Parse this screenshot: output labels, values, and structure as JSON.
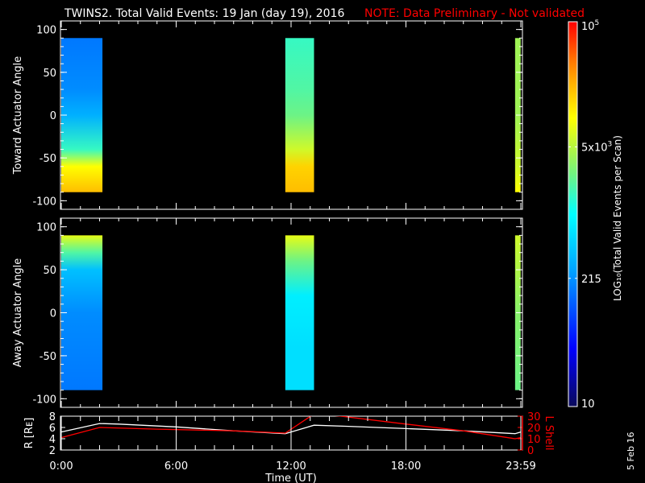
{
  "title": "TWINS2. Total Valid Events: 19 Jan (day  19), 2016",
  "note": "NOTE: Data Preliminary - Not validated",
  "colors": {
    "note": "#ff0000",
    "axis": "#ffffff",
    "lshell": "#ff0000",
    "r": "#ffffff"
  },
  "date_stamp": "5 Feb 16",
  "chart_data": [
    {
      "type": "heatmap",
      "ylabel": "Toward Actuator Angle",
      "ylim": [
        -110,
        110
      ],
      "yticks": [
        "100",
        "50",
        "0",
        "-50",
        "-100"
      ],
      "xlim_hours": [
        0,
        24
      ],
      "blocks": [
        {
          "start_h": 0.0,
          "end_h": 2.15,
          "angle_profile": [
            {
              "angle": 90,
              "log": 2.2
            },
            {
              "angle": 30,
              "log": 2.3
            },
            {
              "angle": 0,
              "log": 2.5
            },
            {
              "angle": -40,
              "log": 3.2
            },
            {
              "angle": -60,
              "log": 4.0
            },
            {
              "angle": -90,
              "log": 4.3
            }
          ]
        },
        {
          "start_h": 11.7,
          "end_h": 13.2,
          "angle_profile": [
            {
              "angle": 90,
              "log": 3.2
            },
            {
              "angle": 30,
              "log": 3.3
            },
            {
              "angle": 0,
              "log": 3.4
            },
            {
              "angle": -40,
              "log": 3.8
            },
            {
              "angle": -60,
              "log": 4.2
            },
            {
              "angle": -90,
              "log": 4.3
            }
          ]
        },
        {
          "start_h": 23.7,
          "end_h": 23.99,
          "angle_profile": [
            {
              "angle": 90,
              "log": 3.6
            },
            {
              "angle": 0,
              "log": 3.6
            },
            {
              "angle": -60,
              "log": 3.8
            },
            {
              "angle": -90,
              "log": 4.0
            }
          ]
        }
      ]
    },
    {
      "type": "heatmap",
      "ylabel": "Away Actuator Angle",
      "ylim": [
        -110,
        110
      ],
      "yticks": [
        "100",
        "50",
        "0",
        "-50",
        "-100"
      ],
      "xlim_hours": [
        0,
        24
      ],
      "blocks": [
        {
          "start_h": 0.0,
          "end_h": 2.15,
          "angle_profile": [
            {
              "angle": 90,
              "log": 3.9
            },
            {
              "angle": 70,
              "log": 3.3
            },
            {
              "angle": 50,
              "log": 2.6
            },
            {
              "angle": 0,
              "log": 2.3
            },
            {
              "angle": -90,
              "log": 2.2
            }
          ]
        },
        {
          "start_h": 11.7,
          "end_h": 13.2,
          "angle_profile": [
            {
              "angle": 90,
              "log": 3.9
            },
            {
              "angle": 60,
              "log": 3.4
            },
            {
              "angle": 20,
              "log": 2.9
            },
            {
              "angle": -40,
              "log": 2.8
            },
            {
              "angle": -90,
              "log": 2.8
            }
          ]
        },
        {
          "start_h": 23.7,
          "end_h": 23.99,
          "angle_profile": [
            {
              "angle": 90,
              "log": 3.8
            },
            {
              "angle": 0,
              "log": 3.5
            },
            {
              "angle": -90,
              "log": 3.4
            }
          ]
        }
      ]
    },
    {
      "type": "line",
      "xlabel": "Time (UT)",
      "xticks": [
        "0:00",
        "6:00",
        "12:00",
        "18:00",
        "23:59"
      ],
      "ylabel": "R [Rᴇ]",
      "ylabel_right": "L Shell",
      "ylim": [
        2,
        8
      ],
      "ylim_right": [
        0,
        30
      ],
      "yticks": [
        "2",
        "4",
        "6",
        "8"
      ],
      "yticks_right": [
        "0",
        "10",
        "20",
        "30"
      ],
      "series": [
        {
          "name": "R",
          "axis": "left",
          "x": [
            0,
            2,
            3,
            6,
            9,
            11.7,
            13.2,
            15,
            18,
            21,
            23.7,
            24
          ],
          "y": [
            5.2,
            6.7,
            6.6,
            6.1,
            5.4,
            4.9,
            6.4,
            6.2,
            5.8,
            5.4,
            4.9,
            5.2
          ]
        },
        {
          "name": "L Shell",
          "axis": "right",
          "x": [
            0,
            2,
            5,
            9,
            11.7,
            13.2,
            14.6,
            18,
            21,
            23.7,
            24
          ],
          "y": [
            11,
            20,
            18.5,
            17,
            15,
            32,
            30,
            23,
            17,
            10,
            11
          ]
        }
      ]
    },
    {
      "type": "colorbar",
      "label": "LOG₁₀(Total Valid Events per Scan)",
      "range_log": [
        1,
        5
      ],
      "ticks": [
        {
          "value": 10,
          "label": "10"
        },
        {
          "value": 215,
          "label": "215"
        },
        {
          "value": 5000,
          "label": "5x10",
          "sup": "3"
        },
        {
          "value": 100000,
          "label": "10",
          "sup": "5"
        }
      ]
    }
  ]
}
